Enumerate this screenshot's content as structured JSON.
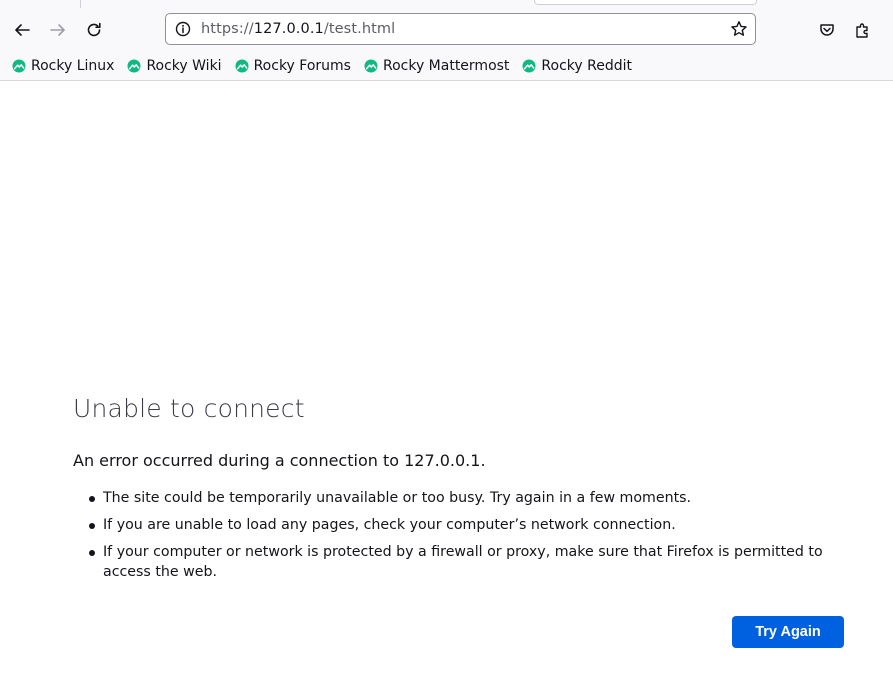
{
  "browser": {
    "url": {
      "scheme": "https://",
      "host": "127.0.0.1",
      "path": "/test.html"
    },
    "bookmarks": [
      {
        "label": "Rocky Linux",
        "icon": "rocky-logo-icon"
      },
      {
        "label": "Rocky Wiki",
        "icon": "rocky-logo-icon"
      },
      {
        "label": "Rocky Forums",
        "icon": "rocky-logo-icon"
      },
      {
        "label": "Rocky Mattermost",
        "icon": "rocky-logo-icon"
      },
      {
        "label": "Rocky Reddit",
        "icon": "rocky-logo-icon"
      }
    ],
    "icons": {
      "back": "arrow-left-icon",
      "forward": "arrow-right-icon",
      "reload": "reload-icon",
      "site_info": "info-icon",
      "bookmark_star": "star-icon",
      "pocket": "pocket-icon",
      "extensions": "puzzle-icon"
    },
    "colors": {
      "accent": "#0061e0",
      "rocky_green": "#10b981"
    }
  },
  "error_page": {
    "title": "Unable to connect",
    "description": "An error occurred during a connection to 127.0.0.1.",
    "items": [
      "The site could be temporarily unavailable or too busy. Try again in a few moments.",
      "If you are unable to load any pages, check your computer’s network connection.",
      "If your computer or network is protected by a firewall or proxy, make sure that Firefox is permitted to access the web."
    ],
    "try_again_label": "Try Again"
  }
}
